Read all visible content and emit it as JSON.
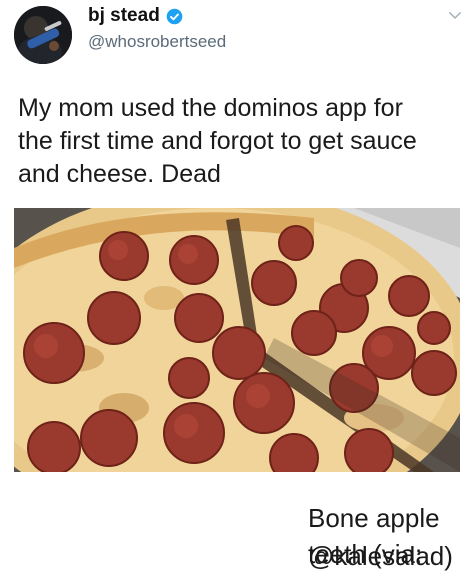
{
  "tweet": {
    "display_name": "bj stead",
    "handle": "@whosrobertseed",
    "text": "My mom used the dominos app for\nthe first time and forgot to get sauce\nand cheese. Dead",
    "verified": true,
    "icons": {
      "verified": "verified-badge-icon",
      "more": "chevron-down-icon"
    },
    "colors": {
      "verified_blue": "#1da1f2",
      "handle_gray": "#5b6b78"
    }
  },
  "caption": {
    "line1": "Bone apple teeth (via:",
    "line2": "@kalesalad)"
  }
}
